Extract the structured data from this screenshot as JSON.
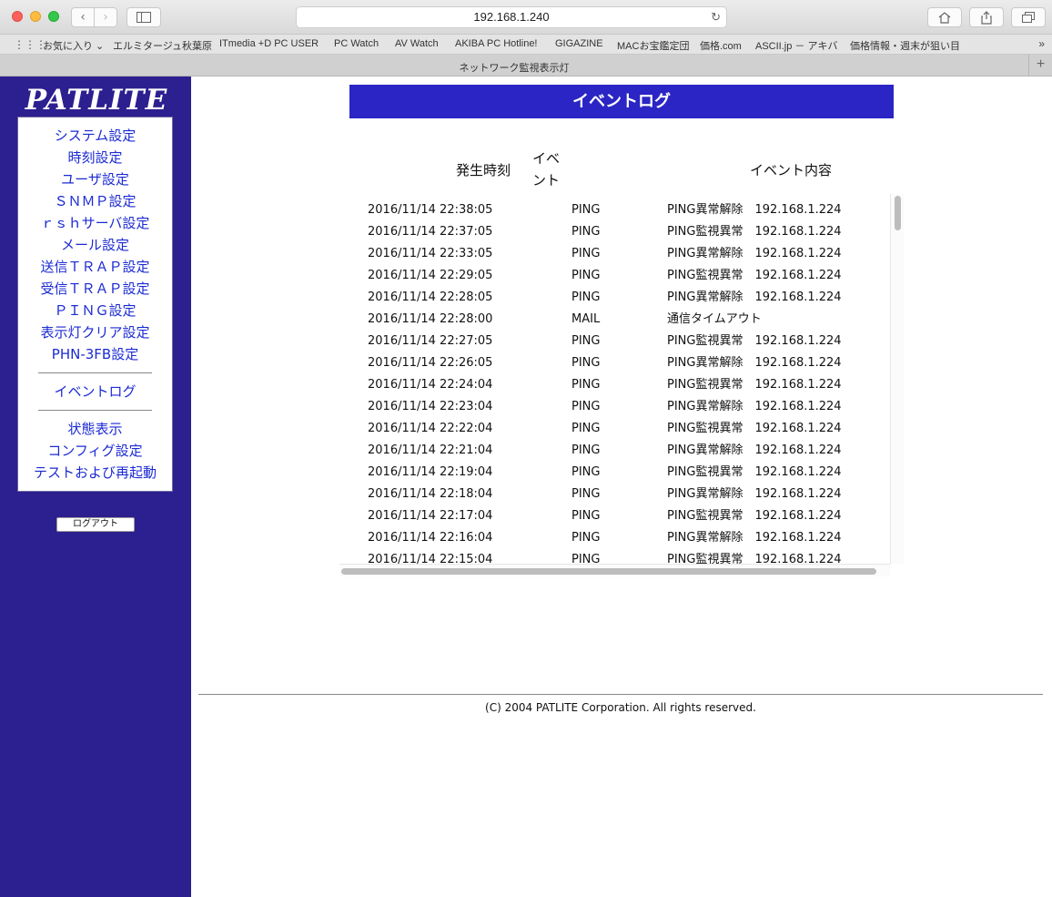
{
  "browser": {
    "url": "192.168.1.240",
    "tab_title": "ネットワーク監視表示灯",
    "bookmarks": [
      "お気に入り ⌄",
      "エルミタージュ秋葉原",
      "ITmedia +D PC USER",
      "PC Watch",
      "AV Watch",
      "AKIBA PC Hotline!",
      "GIGAZINE",
      "MACお宝鑑定団",
      "価格.com",
      "ASCII.jp － アキバ",
      "価格情報・週末が狙い目"
    ]
  },
  "sidebar": {
    "logo": "PATLITE",
    "items": [
      {
        "label": "システム設定"
      },
      {
        "label": "時刻設定"
      },
      {
        "label": "ユーザ設定"
      },
      {
        "label": "ＳＮＭＰ設定"
      },
      {
        "label": "ｒｓｈサーバ設定"
      },
      {
        "label": "メール設定"
      },
      {
        "label": "送信ＴＲＡＰ設定"
      },
      {
        "label": "受信ＴＲＡＰ設定"
      },
      {
        "label": "ＰＩＮＧ設定"
      },
      {
        "label": "表示灯クリア設定"
      },
      {
        "label": "PHN-3FB設定"
      }
    ],
    "event_log": "イベントログ",
    "items2": [
      {
        "label": "状態表示"
      },
      {
        "label": "コンフィグ設定"
      },
      {
        "label": "テストおよび再起動"
      }
    ],
    "logout": "ログアウト"
  },
  "main": {
    "title": "イベントログ",
    "headers": {
      "time": "発生時刻",
      "type": "イベント",
      "detail": "イベント内容"
    },
    "rows": [
      {
        "time": "2016/11/14 22:38:05",
        "type": "PING",
        "detail": "PING異常解除　192.168.1.224"
      },
      {
        "time": "2016/11/14 22:37:05",
        "type": "PING",
        "detail": "PING監視異常　192.168.1.224"
      },
      {
        "time": "2016/11/14 22:33:05",
        "type": "PING",
        "detail": "PING異常解除　192.168.1.224"
      },
      {
        "time": "2016/11/14 22:29:05",
        "type": "PING",
        "detail": "PING監視異常　192.168.1.224"
      },
      {
        "time": "2016/11/14 22:28:05",
        "type": "PING",
        "detail": "PING異常解除　192.168.1.224"
      },
      {
        "time": "2016/11/14 22:28:00",
        "type": "MAIL",
        "detail": "通信タイムアウト"
      },
      {
        "time": "2016/11/14 22:27:05",
        "type": "PING",
        "detail": "PING監視異常　192.168.1.224"
      },
      {
        "time": "2016/11/14 22:26:05",
        "type": "PING",
        "detail": "PING異常解除　192.168.1.224"
      },
      {
        "time": "2016/11/14 22:24:04",
        "type": "PING",
        "detail": "PING監視異常　192.168.1.224"
      },
      {
        "time": "2016/11/14 22:23:04",
        "type": "PING",
        "detail": "PING異常解除　192.168.1.224"
      },
      {
        "time": "2016/11/14 22:22:04",
        "type": "PING",
        "detail": "PING監視異常　192.168.1.224"
      },
      {
        "time": "2016/11/14 22:21:04",
        "type": "PING",
        "detail": "PING異常解除　192.168.1.224"
      },
      {
        "time": "2016/11/14 22:19:04",
        "type": "PING",
        "detail": "PING監視異常　192.168.1.224"
      },
      {
        "time": "2016/11/14 22:18:04",
        "type": "PING",
        "detail": "PING異常解除　192.168.1.224"
      },
      {
        "time": "2016/11/14 22:17:04",
        "type": "PING",
        "detail": "PING監視異常　192.168.1.224"
      },
      {
        "time": "2016/11/14 22:16:04",
        "type": "PING",
        "detail": "PING異常解除　192.168.1.224"
      },
      {
        "time": "2016/11/14 22:15:04",
        "type": "PING",
        "detail": "PING監視異常　192.168.1.224"
      }
    ],
    "footer": "(C) 2004 PATLITE Corporation. All rights reserved."
  }
}
